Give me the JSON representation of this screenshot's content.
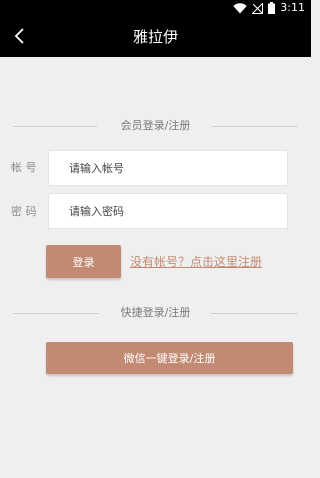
{
  "status_bar": {
    "time": "3:11",
    "icons": [
      "wifi-icon",
      "signal-off-icon",
      "battery-icon"
    ]
  },
  "header": {
    "title": "雅拉伊",
    "back_icon": "chevron-left-icon"
  },
  "member_section": {
    "heading": "会员登录/注册"
  },
  "account_field": {
    "label": "帐 号",
    "placeholder": "请输入帐号"
  },
  "password_field": {
    "label": "密 码",
    "placeholder": "请输入密码"
  },
  "actions": {
    "login_label": "登录",
    "register_link": "没有帐号？点击这里注册"
  },
  "quick_section": {
    "heading": "快捷登录/注册",
    "wechat_button": "微信一键登录/注册"
  },
  "colors": {
    "accent": "#c38a73",
    "background": "#efefef",
    "header": "#000000"
  }
}
